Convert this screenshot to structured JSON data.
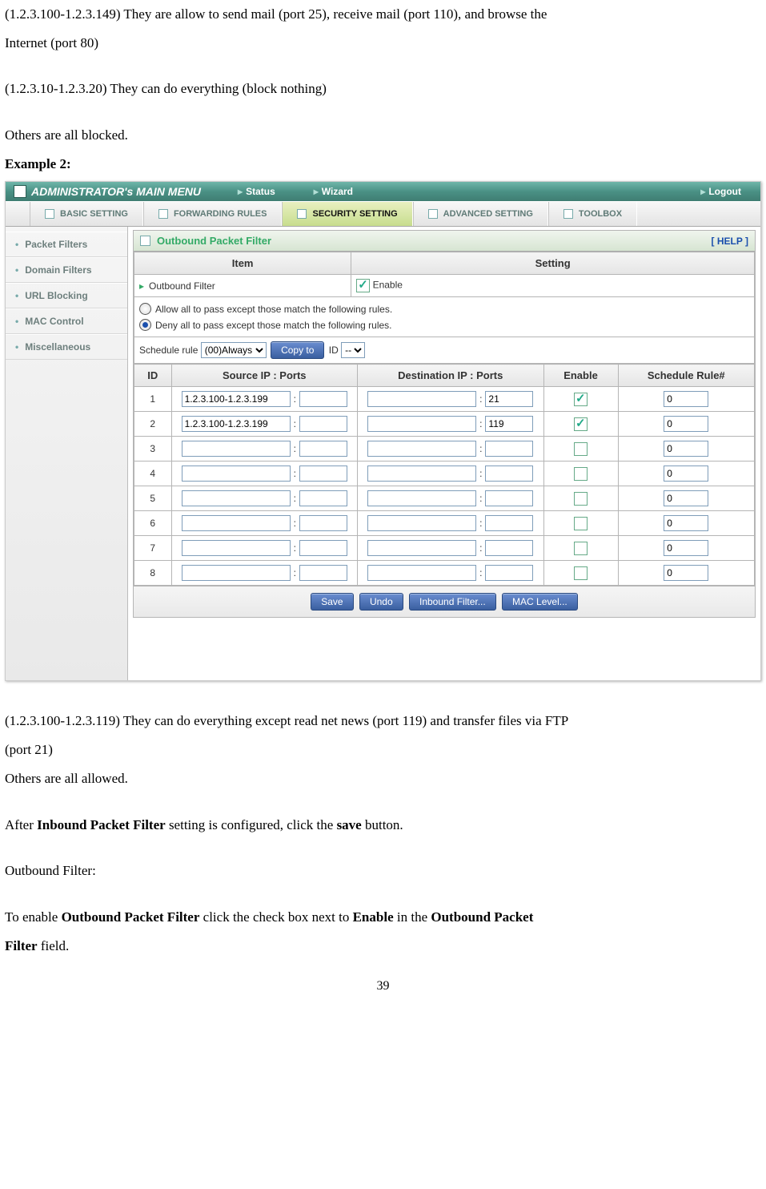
{
  "intro": {
    "line1": "(1.2.3.100-1.2.3.149) They are allow to send mail (port 25), receive mail (port 110), and browse the",
    "line2": "Internet (port 80)",
    "line3": "(1.2.3.10-1.2.3.20) They can do everything (block nothing)",
    "line4": "Others are all blocked.",
    "line5": "Example 2:"
  },
  "screenshot": {
    "topbar": {
      "title": "ADMINISTRATOR's MAIN MENU",
      "menu_status": "Status",
      "menu_wizard": "Wizard",
      "menu_logout": "Logout"
    },
    "tabs": {
      "basic": "BASIC SETTING",
      "forwarding": "FORWARDING RULES",
      "security": "SECURITY SETTING",
      "advanced": "ADVANCED SETTING",
      "toolbox": "TOOLBOX"
    },
    "sidebar": [
      "Packet Filters",
      "Domain Filters",
      "URL Blocking",
      "MAC Control",
      "Miscellaneous"
    ],
    "panel": {
      "title": "Outbound Packet Filter",
      "help": "[ HELP ]",
      "header_item": "Item",
      "header_setting": "Setting",
      "outbound_label": "Outbound Filter",
      "enable_label": " Enable",
      "radio_allow": "Allow all to pass except those match the following rules.",
      "radio_deny": "Deny all to pass except those match the following rules.",
      "schedule_label": "Schedule rule ",
      "schedule_select": "(00)Always",
      "copyto_btn": "Copy to",
      "id_label": " ID ",
      "id_select": "--",
      "cols": {
        "id": "ID",
        "src": "Source IP : Ports",
        "dst": "Destination IP : Ports",
        "enable": "Enable",
        "sched": "Schedule Rule#"
      },
      "rows": [
        {
          "id": "1",
          "sip": "1.2.3.100-1.2.3.199",
          "sport": "",
          "dip": "",
          "dport": "21",
          "enabled": true,
          "sched": "0"
        },
        {
          "id": "2",
          "sip": "1.2.3.100-1.2.3.199",
          "sport": "",
          "dip": "",
          "dport": "119",
          "enabled": true,
          "sched": "0"
        },
        {
          "id": "3",
          "sip": "",
          "sport": "",
          "dip": "",
          "dport": "",
          "enabled": false,
          "sched": "0"
        },
        {
          "id": "4",
          "sip": "",
          "sport": "",
          "dip": "",
          "dport": "",
          "enabled": false,
          "sched": "0"
        },
        {
          "id": "5",
          "sip": "",
          "sport": "",
          "dip": "",
          "dport": "",
          "enabled": false,
          "sched": "0"
        },
        {
          "id": "6",
          "sip": "",
          "sport": "",
          "dip": "",
          "dport": "",
          "enabled": false,
          "sched": "0"
        },
        {
          "id": "7",
          "sip": "",
          "sport": "",
          "dip": "",
          "dport": "",
          "enabled": false,
          "sched": "0"
        },
        {
          "id": "8",
          "sip": "",
          "sport": "",
          "dip": "",
          "dport": "",
          "enabled": false,
          "sched": "0"
        }
      ],
      "buttons": {
        "save": "Save",
        "undo": "Undo",
        "inbound": "Inbound Filter...",
        "mac": "MAC Level..."
      }
    }
  },
  "outro": {
    "l1": "(1.2.3.100-1.2.3.119) They can do everything except read net news (port 119) and transfer files via FTP",
    "l2": "(port 21)",
    "l3": "Others are all allowed.",
    "l4a": "After ",
    "l4b": "Inbound Packet Filter",
    "l4c": " setting is configured, click the ",
    "l4d": "save",
    "l4e": " button.",
    "l5": "Outbound Filter:",
    "l6a": "To enable ",
    "l6b": "Outbound Packet Filter",
    "l6c": " click the check box next to ",
    "l6d": "Enable",
    "l6e": " in the ",
    "l6f": "Outbound Packet",
    "l7a": "Filter",
    "l7b": " field."
  },
  "page_number": "39"
}
